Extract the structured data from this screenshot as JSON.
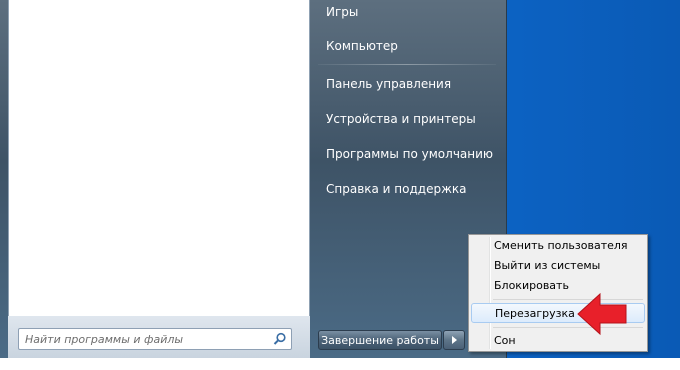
{
  "start_menu": {
    "right_pane": {
      "items": [
        {
          "label": "Игры"
        },
        {
          "label": "Компьютер"
        },
        {
          "label": "Панель управления"
        },
        {
          "label": "Устройства и принтеры"
        },
        {
          "label": "Программы по умолчанию"
        },
        {
          "label": "Справка и поддержка"
        }
      ]
    },
    "search": {
      "placeholder": "Найти программы и файлы",
      "value": ""
    },
    "shutdown": {
      "label": "Завершение работы"
    }
  },
  "shutdown_submenu": {
    "items": [
      {
        "label": "Сменить пользователя"
      },
      {
        "label": "Выйти из системы"
      },
      {
        "label": "Блокировать"
      },
      {
        "label": "Перезагрузка",
        "highlighted": true
      },
      {
        "label": "Сон"
      }
    ]
  },
  "annotation": {
    "arrow_color": "#e8202a",
    "arrow_icon": "red-arrow-icon"
  },
  "colors": {
    "desktop": "#0f66c4",
    "start_menu_dark": "#3e5366",
    "menu_highlight_border": "#a8cbf1"
  }
}
